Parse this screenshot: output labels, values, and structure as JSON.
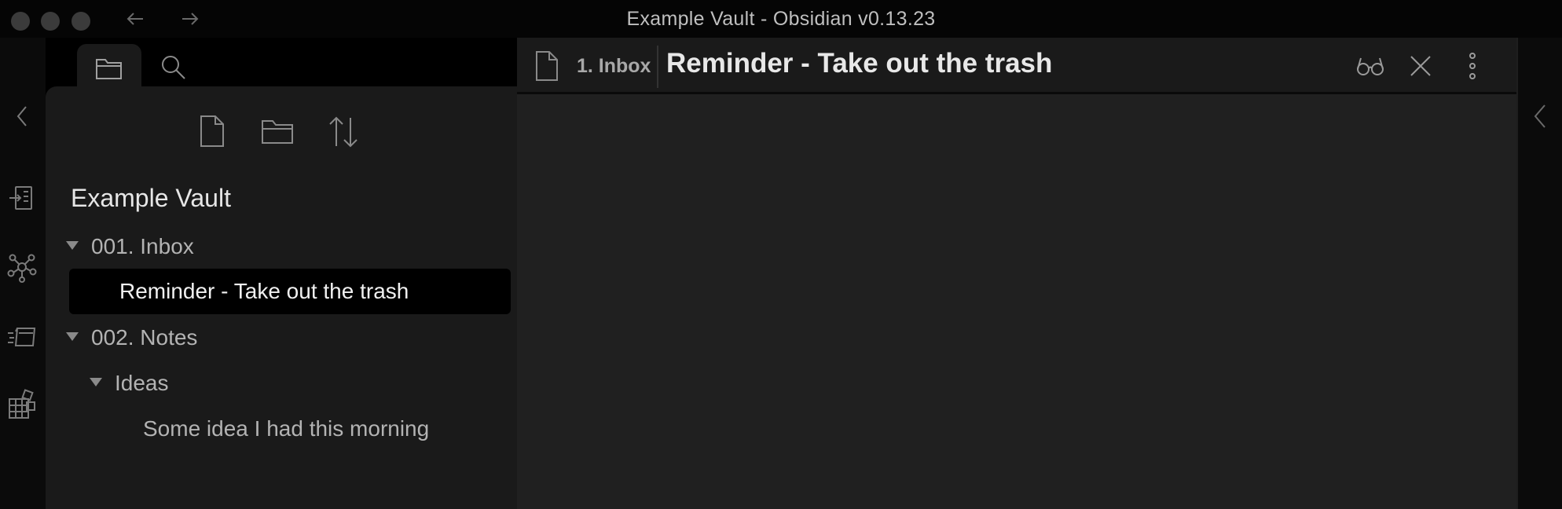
{
  "window": {
    "title": "Example Vault - Obsidian v0.13.23"
  },
  "titlebar": {
    "back_icon": "arrow-left-icon",
    "forward_icon": "arrow-right-icon"
  },
  "ribbon": {
    "items": [
      {
        "icon": "chevron-left-icon",
        "action": "collapse-left"
      },
      {
        "icon": "open-quick-switcher-icon"
      },
      {
        "icon": "graph-view-icon"
      },
      {
        "icon": "slides-icon"
      },
      {
        "icon": "blocks-icon"
      }
    ]
  },
  "sidebar": {
    "tabs": [
      {
        "icon": "folder-icon",
        "active": true
      },
      {
        "icon": "search-icon",
        "active": false
      }
    ],
    "toolbar": [
      {
        "icon": "new-note-icon"
      },
      {
        "icon": "new-folder-icon"
      },
      {
        "icon": "sort-icon"
      }
    ],
    "vault_name": "Example Vault",
    "tree": {
      "inbox_folder": "001. Inbox",
      "inbox_note": "Reminder - Take out the trash",
      "notes_folder": "002. Notes",
      "ideas_folder": "Ideas",
      "ideas_note": "Some idea I had this morning"
    }
  },
  "editor": {
    "breadcrumb": "1. Inbox",
    "title": "Reminder - Take out the trash",
    "actions": [
      {
        "icon": "preview-glasses-icon"
      },
      {
        "icon": "close-icon"
      },
      {
        "icon": "more-options-icon"
      }
    ]
  },
  "colors": {
    "background": "#202020",
    "sidebar": "#1a1a1a",
    "selected_row": "#000000",
    "text": "#dcddde"
  }
}
